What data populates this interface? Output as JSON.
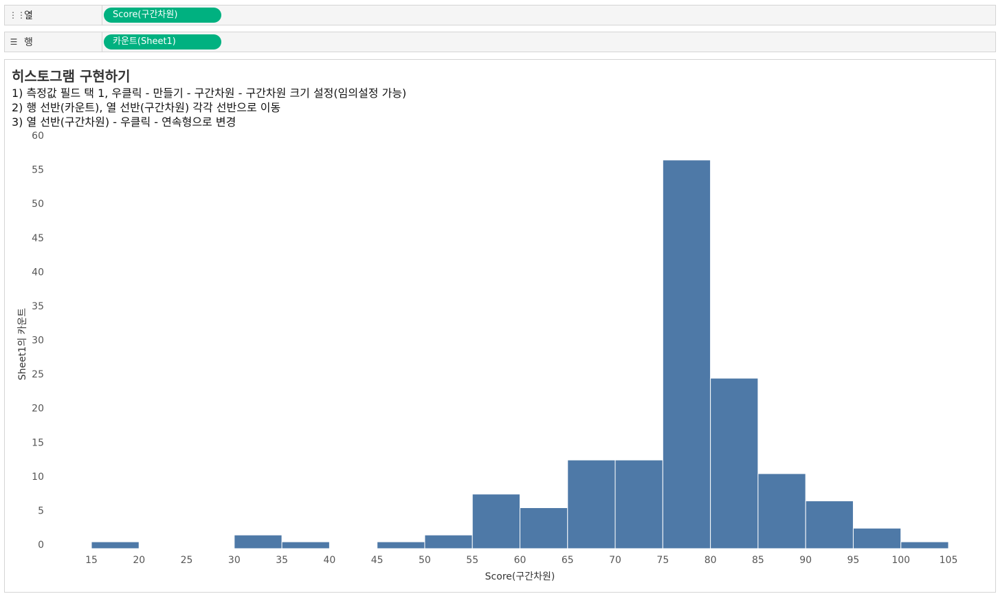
{
  "shelves": {
    "columns": {
      "label": "열",
      "icon": "columns-icon",
      "pill": "Score(구간차원)"
    },
    "rows": {
      "label": "행",
      "icon": "rows-icon",
      "pill": "카운트(Sheet1)"
    },
    "pill_color": "#00b180"
  },
  "sheet": {
    "title": "히스토그램 구현하기",
    "steps": [
      "1) 측정값 필드 택 1, 우클릭 - 만들기 - 구간차원 - 구간차원 크기 설정(임의설정 가능)",
      "2) 행 선반(카운트), 열 선반(구간차원) 각각 선반으로 이동",
      "3) 열 선반(구간차원) - 우클릭 - 연속형으로 변경"
    ]
  },
  "chart_data": {
    "type": "bar",
    "title": "",
    "xlabel": "Score(구간차원)",
    "ylabel": "Sheet1의 카운트",
    "bar_color": "#4e79a7",
    "bin_width": 5,
    "bins": [
      {
        "start": 15,
        "count": 1
      },
      {
        "start": 30,
        "count": 2
      },
      {
        "start": 35,
        "count": 1
      },
      {
        "start": 45,
        "count": 1
      },
      {
        "start": 50,
        "count": 2
      },
      {
        "start": 55,
        "count": 8
      },
      {
        "start": 60,
        "count": 6
      },
      {
        "start": 65,
        "count": 13
      },
      {
        "start": 70,
        "count": 13
      },
      {
        "start": 75,
        "count": 57
      },
      {
        "start": 80,
        "count": 25
      },
      {
        "start": 85,
        "count": 11
      },
      {
        "start": 90,
        "count": 7
      },
      {
        "start": 95,
        "count": 3
      },
      {
        "start": 100,
        "count": 1
      }
    ],
    "xlim": [
      15,
      105
    ],
    "ylim": [
      0,
      60
    ],
    "x_ticks": [
      15,
      20,
      25,
      30,
      35,
      40,
      45,
      50,
      55,
      60,
      65,
      70,
      75,
      80,
      85,
      90,
      95,
      100,
      105
    ],
    "y_ticks": [
      0,
      5,
      10,
      15,
      20,
      25,
      30,
      35,
      40,
      45,
      50,
      55,
      60
    ],
    "grid": false,
    "legend": "none"
  }
}
